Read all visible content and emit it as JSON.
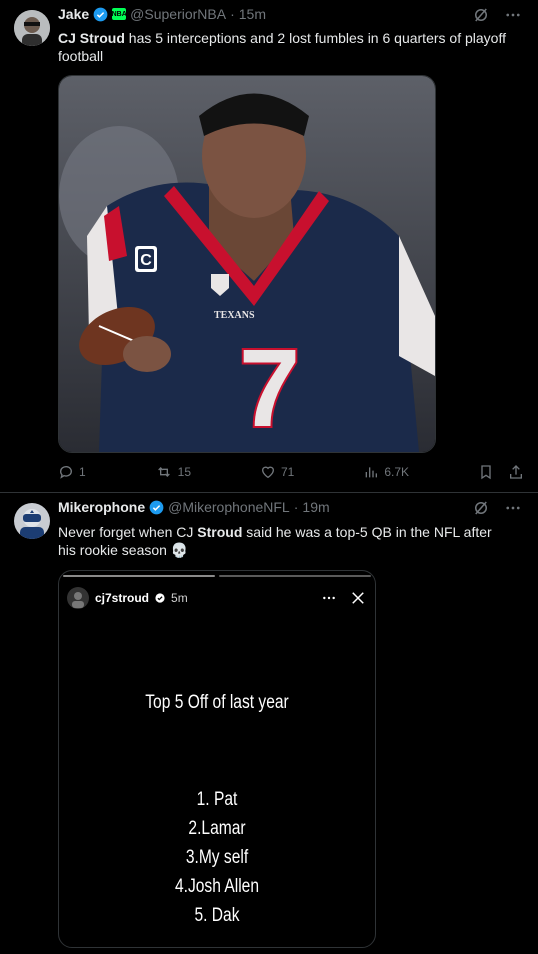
{
  "tweet1": {
    "name": "Jake",
    "handle": "@SuperiorNBA",
    "time": "15m",
    "text_bold": "CJ Stroud",
    "text_rest": " has 5 interceptions and 2 lost fumbles in 6 quarters of playoff football",
    "image_jersey_text": "TEXANS",
    "image_number": "7",
    "image_patch": "C",
    "actions": {
      "replies": "1",
      "reposts": "15",
      "likes": "71",
      "views": "6.7K"
    }
  },
  "tweet2": {
    "name": "Mikerophone",
    "handle": "@MikerophoneNFL",
    "time": "19m",
    "text_pre": "Never forget when CJ ",
    "text_bold": "Stroud",
    "text_post": " said he was a top-5 QB in the NFL after his rookie season",
    "emoji": "💀",
    "story": {
      "username": "cj7stroud",
      "time": "5m",
      "title": "Top 5 Off of last year",
      "list": [
        "1. Pat",
        "2.Lamar",
        "3.My self",
        "4.Josh Allen",
        "5. Dak"
      ]
    }
  },
  "colors": {
    "verified": "#1d9bf0",
    "muted": "#71767b",
    "text": "#e7e9ea",
    "border": "#2f3336"
  }
}
